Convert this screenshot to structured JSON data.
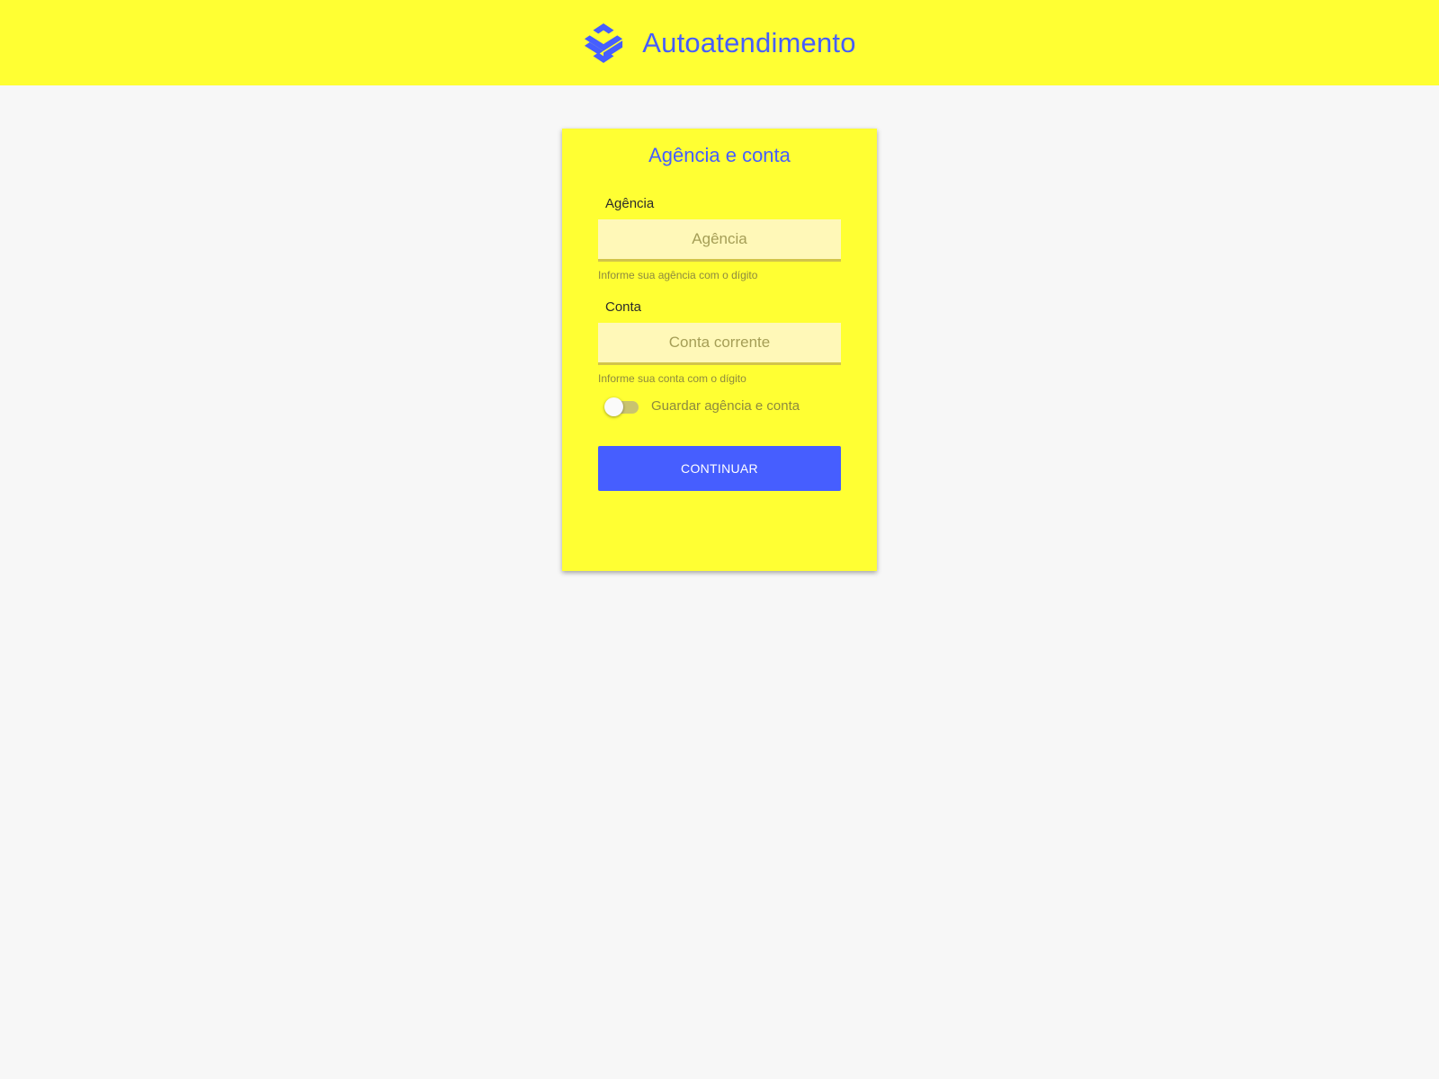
{
  "header": {
    "title": "Autoatendimento",
    "logo_icon": "banco-do-brasil-logo-icon"
  },
  "form": {
    "title": "Agência e conta",
    "agencia": {
      "label": "Agência",
      "placeholder": "Agência",
      "value": "",
      "helper": "Informe sua agência com o dígito"
    },
    "conta": {
      "label": "Conta",
      "placeholder": "Conta corrente",
      "value": "",
      "helper": "Informe sua conta com o dígito"
    },
    "remember": {
      "label": "Guardar agência e conta",
      "checked": false
    },
    "continue_label": "CONTINUAR"
  },
  "colors": {
    "brand_yellow": "#ffff33",
    "brand_blue": "#465eff",
    "page_background": "#f7f7f7",
    "input_background": "#fff8b8"
  }
}
